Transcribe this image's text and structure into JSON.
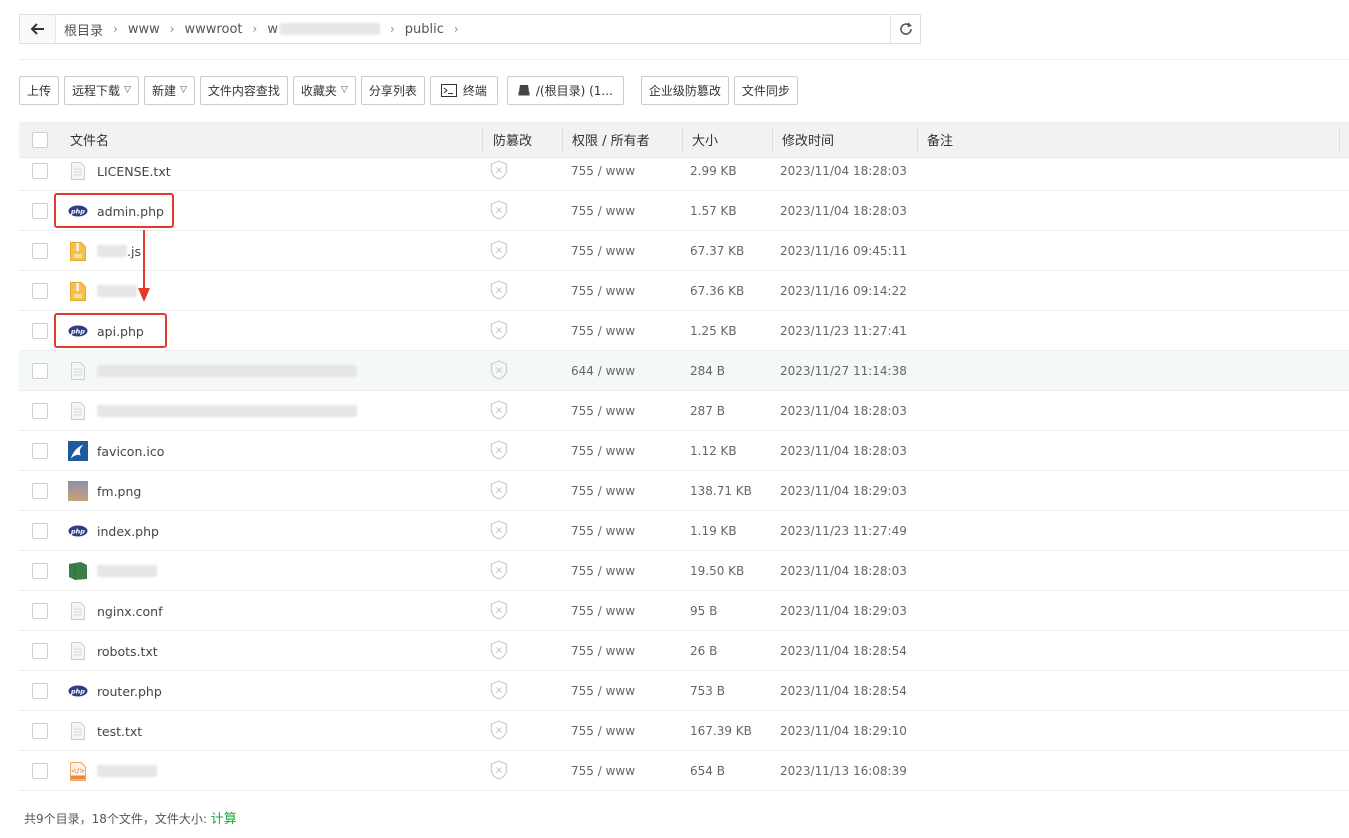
{
  "path": {
    "segments": [
      "根目录",
      "www",
      "wwwroot",
      "w",
      "public"
    ]
  },
  "toolbar": {
    "upload": "上传",
    "remote_download": "远程下载",
    "new": "新建",
    "content_search": "文件内容查找",
    "favorites": "收藏夹",
    "share_list": "分享列表",
    "terminal": "终端",
    "disk": "/(根目录) (1...",
    "tamper_proof": "企业级防篡改",
    "file_sync": "文件同步"
  },
  "table": {
    "headers": {
      "name": "文件名",
      "tamper": "防篡改",
      "perm": "权限 / 所有者",
      "size": "大小",
      "mtime": "修改时间",
      "note": "备注"
    },
    "rows": [
      {
        "name": "LICENSE.txt",
        "icon": "text-file-icon",
        "perm": "755 / www",
        "size": "2.99 KB",
        "mtime": "2023/11/04 18:28:03"
      },
      {
        "name": "admin.php",
        "icon": "php-file-icon",
        "perm": "755 / www",
        "size": "1.57 KB",
        "mtime": "2023/11/04 18:28:03"
      },
      {
        "name": ".js",
        "icon": "archive-file-icon",
        "perm": "755 / www",
        "size": "67.37 KB",
        "mtime": "2023/11/16 09:45:11"
      },
      {
        "name": "",
        "icon": "archive-file-icon",
        "perm": "755 / www",
        "size": "67.36 KB",
        "mtime": "2023/11/16 09:14:22"
      },
      {
        "name": "api.php",
        "icon": "php-file-icon",
        "perm": "755 / www",
        "size": "1.25 KB",
        "mtime": "2023/11/23 11:27:41"
      },
      {
        "name": "",
        "icon": "text-file-icon",
        "perm": "644 / www",
        "size": "284 B",
        "mtime": "2023/11/27 11:14:38"
      },
      {
        "name": "",
        "icon": "text-file-icon",
        "perm": "755 / www",
        "size": "287 B",
        "mtime": "2023/11/04 18:28:03"
      },
      {
        "name": "favicon.ico",
        "icon": "favicon-image-icon",
        "perm": "755 / www",
        "size": "1.12 KB",
        "mtime": "2023/11/04 18:28:03"
      },
      {
        "name": "fm.png",
        "icon": "image-thumbnail-icon",
        "perm": "755 / www",
        "size": "138.71 KB",
        "mtime": "2023/11/04 18:29:03"
      },
      {
        "name": "index.php",
        "icon": "php-file-icon",
        "perm": "755 / www",
        "size": "1.19 KB",
        "mtime": "2023/11/23 11:27:49"
      },
      {
        "name": "",
        "icon": "green-file-icon",
        "perm": "755 / www",
        "size": "19.50 KB",
        "mtime": "2023/11/04 18:28:03"
      },
      {
        "name": "nginx.conf",
        "icon": "text-file-icon",
        "perm": "755 / www",
        "size": "95 B",
        "mtime": "2023/11/04 18:29:03"
      },
      {
        "name": "robots.txt",
        "icon": "text-file-icon",
        "perm": "755 / www",
        "size": "26 B",
        "mtime": "2023/11/04 18:28:54"
      },
      {
        "name": "router.php",
        "icon": "php-file-icon",
        "perm": "755 / www",
        "size": "753 B",
        "mtime": "2023/11/04 18:28:54"
      },
      {
        "name": "test.txt",
        "icon": "text-file-icon",
        "perm": "755 / www",
        "size": "167.39 KB",
        "mtime": "2023/11/04 18:29:10"
      },
      {
        "name": "",
        "icon": "html-file-icon",
        "perm": "755 / www",
        "size": "654 B",
        "mtime": "2023/11/13 16:08:39"
      }
    ]
  },
  "footer": {
    "summary": "共9个目录，18个文件，文件大小:",
    "calc": "计算"
  },
  "colors": {
    "accent_green": "#20a53a",
    "annotation_red": "#e23b2e",
    "php_blue": "#2f3f86",
    "highlight_row": "#f4f9f7"
  }
}
